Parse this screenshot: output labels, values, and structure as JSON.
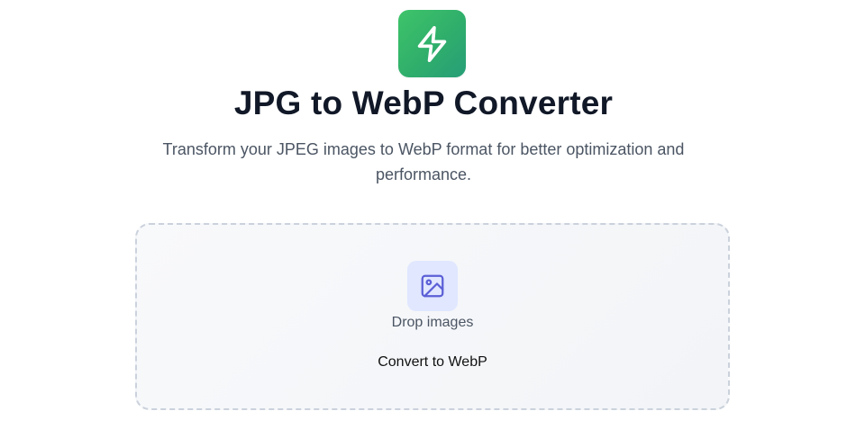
{
  "header": {
    "logo_icon": "lightning-bolt-icon",
    "logo_gradient": [
      "#3fc46a",
      "#279e78"
    ],
    "title": "JPG to WebP Converter",
    "subtitle": "Transform your JPEG images to WebP format for better optimization and performance."
  },
  "dropzone": {
    "icon": "image-icon",
    "icon_color": "#5b5fd6",
    "icon_background": "#e0e7ff",
    "label": "Drop images",
    "button_label": "Convert to WebP"
  }
}
